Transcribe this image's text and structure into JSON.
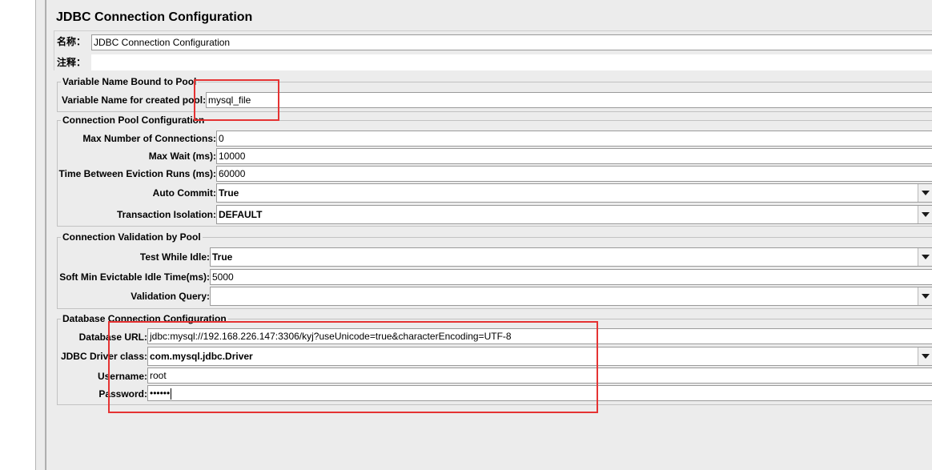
{
  "panel": {
    "title": "JDBC Connection Configuration",
    "name_label": "名称：",
    "name_value": "JDBC Connection Configuration",
    "comment_label": "注释：",
    "comment_value": ""
  },
  "variable_group": {
    "title": "Variable Name Bound to Pool",
    "var_label": "Variable Name for created pool:",
    "var_value": "mysql_file"
  },
  "pool_group": {
    "title": "Connection Pool Configuration",
    "max_conn_label": "Max Number of Connections:",
    "max_conn_value": "0",
    "max_wait_label": "Max Wait (ms):",
    "max_wait_value": "10000",
    "eviction_label": "Time Between Eviction Runs (ms):",
    "eviction_value": "60000",
    "auto_commit_label": "Auto Commit:",
    "auto_commit_value": "True",
    "isolation_label": "Transaction Isolation:",
    "isolation_value": "DEFAULT"
  },
  "validation_group": {
    "title": "Connection Validation by Pool",
    "test_idle_label": "Test While Idle:",
    "test_idle_value": "True",
    "soft_min_label": "Soft Min Evictable Idle Time(ms):",
    "soft_min_value": "5000",
    "query_label": "Validation Query:",
    "query_value": ""
  },
  "db_group": {
    "title": "Database Connection Configuration",
    "url_label": "Database URL:",
    "url_value": "jdbc:mysql://192.168.226.147:3306/kyj?useUnicode=true&characterEncoding=UTF-8",
    "driver_label": "JDBC Driver class:",
    "driver_value": "com.mysql.jdbc.Driver",
    "username_label": "Username:",
    "username_value": "root",
    "password_label": "Password:",
    "password_value": "••••••"
  },
  "colors": {
    "highlight_box": "#e53333",
    "panel_bg": "#ececec"
  }
}
